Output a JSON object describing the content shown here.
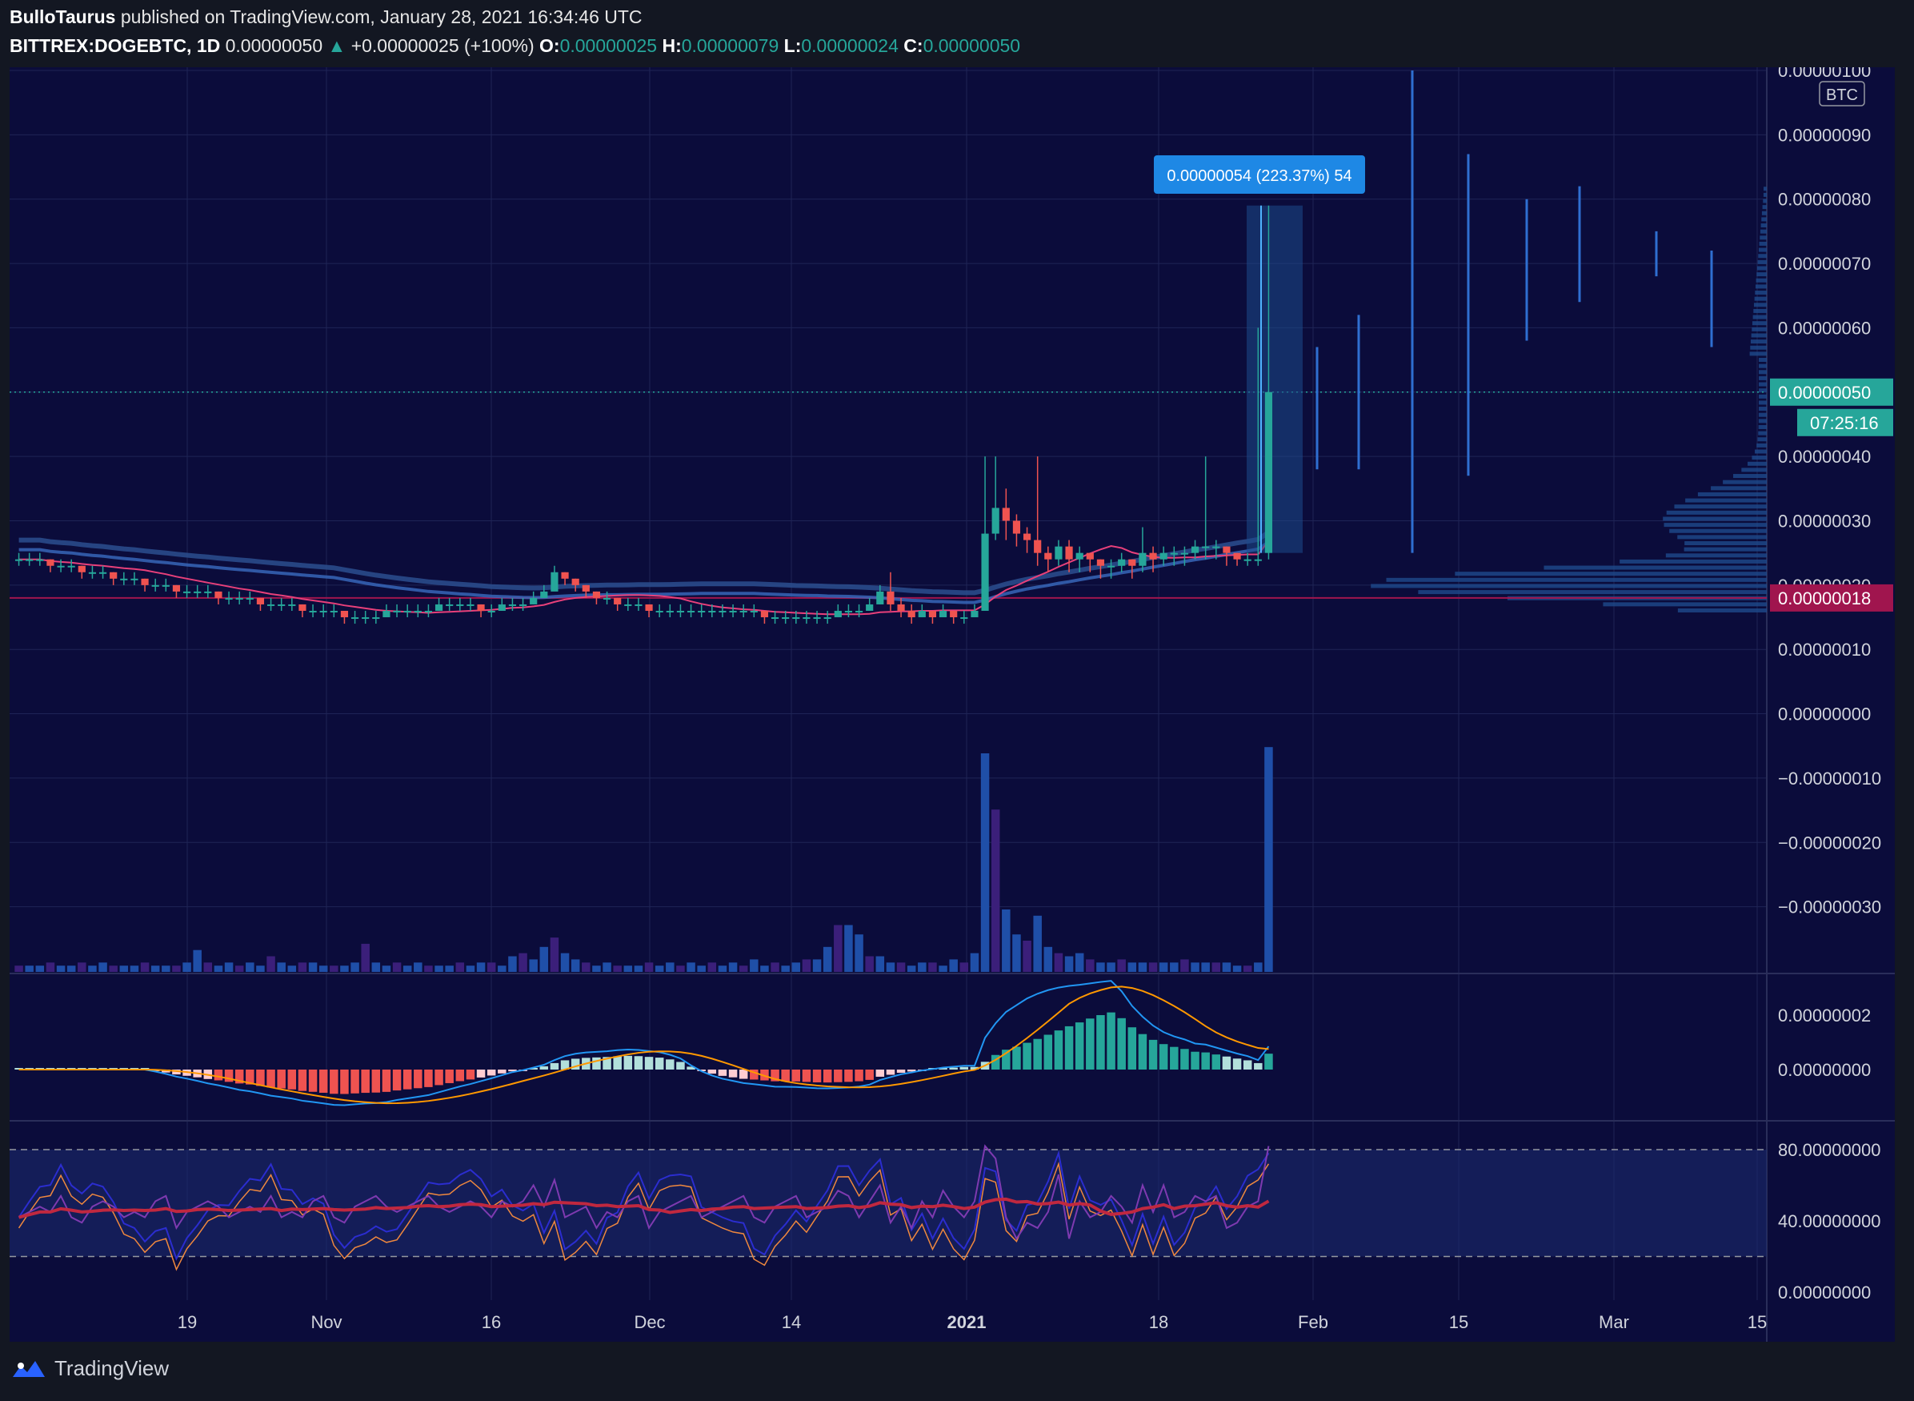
{
  "header": {
    "author": "BulloTaurus",
    "published": "published on TradingView.com, January 28, 2021 16:34:46 UTC",
    "symbol": "BITTREX:DOGEBTC, 1D",
    "last": "0.00000050",
    "change_arrow": "▲",
    "change": "+0.00000025 (+100%)",
    "o_label": "O:",
    "o": "0.00000025",
    "h_label": "H:",
    "h": "0.00000079",
    "l_label": "L:",
    "l": "0.00000024",
    "c_label": "C:",
    "c": "0.00000050"
  },
  "footer": {
    "brand": "TradingView",
    "logo_icon": "tradingview-logo-icon"
  },
  "colors": {
    "up": "#26a69a",
    "down": "#ef5350",
    "bg": "#0b0c3b",
    "accent": "#2962ff",
    "profile": "#1e4a8c",
    "measure": "#1e88e5",
    "low_line": "#a0154e"
  },
  "chart_data": [
    {
      "type": "candlestick",
      "title": "",
      "currency_badge": "BTC",
      "price_axis_labels": [
        "0.00000100",
        "0.00000090",
        "0.00000080",
        "0.00000070",
        "0.00000060",
        "0.00000050",
        "0.00000040",
        "0.00000030",
        "0.00000020",
        "0.00000018",
        "0.00000010",
        "0.00000000",
        "−0.00000010",
        "−0.00000020",
        "−0.00000030"
      ],
      "price_axis_values": [
        100,
        90,
        80,
        70,
        60,
        50,
        40,
        30,
        20,
        18,
        10,
        0,
        -10,
        -20,
        -30
      ],
      "ylim": [
        -35,
        100
      ],
      "value_unit_scale": "1e-8 BTC",
      "x_tick_labels": [
        "19",
        "Nov",
        "16",
        "Dec",
        "14",
        "2021",
        "18",
        "Feb",
        "15",
        "Mar",
        "15"
      ],
      "last_price_label": "0.00000050",
      "countdown_label": "07:25:16",
      "low_line_label": "0.00000018",
      "measure_label": "0.00000054 (223.37%) 54",
      "closes": [
        24,
        24,
        24,
        23,
        23,
        23,
        22,
        22,
        22,
        21,
        21,
        21,
        20,
        20,
        20,
        19,
        19,
        19,
        19,
        18,
        18,
        18,
        18,
        17,
        17,
        17,
        17,
        16,
        16,
        16,
        16,
        15,
        15,
        15,
        15,
        16,
        16,
        16,
        16,
        16,
        17,
        17,
        17,
        17,
        16,
        16,
        17,
        17,
        17,
        18,
        19,
        22,
        21,
        20,
        19,
        18,
        18,
        17,
        17,
        17,
        16,
        16,
        16,
        16,
        16,
        16,
        16,
        16,
        16,
        16,
        16,
        15,
        15,
        15,
        15,
        15,
        15,
        15,
        16,
        16,
        16,
        17,
        19,
        17,
        16,
        15,
        16,
        15,
        16,
        15,
        15,
        16,
        28,
        32,
        30,
        28,
        27,
        25,
        24,
        26,
        24,
        25,
        24,
        23,
        23,
        24,
        23,
        25,
        24,
        25,
        25,
        25,
        26,
        26,
        26,
        25,
        24,
        24,
        24,
        50
      ],
      "opens": [
        24,
        24,
        24,
        24,
        23,
        23,
        23,
        22,
        22,
        22,
        21,
        21,
        21,
        20,
        20,
        20,
        19,
        19,
        19,
        19,
        18,
        18,
        18,
        18,
        17,
        17,
        17,
        17,
        16,
        16,
        16,
        16,
        15,
        15,
        15,
        15,
        16,
        16,
        16,
        16,
        16,
        17,
        17,
        17,
        17,
        16,
        16,
        17,
        17,
        17,
        18,
        19,
        22,
        21,
        20,
        19,
        18,
        18,
        17,
        17,
        17,
        16,
        16,
        16,
        16,
        16,
        16,
        16,
        16,
        16,
        16,
        16,
        15,
        15,
        15,
        15,
        15,
        15,
        15,
        16,
        16,
        16,
        17,
        19,
        17,
        16,
        15,
        16,
        15,
        16,
        15,
        15,
        16,
        28,
        32,
        30,
        28,
        27,
        25,
        24,
        26,
        24,
        25,
        24,
        23,
        23,
        24,
        23,
        25,
        24,
        25,
        25,
        25,
        26,
        26,
        26,
        25,
        24,
        24,
        25
      ],
      "highs": [
        25,
        25,
        25,
        24,
        24,
        24,
        23,
        23,
        23,
        22,
        22,
        22,
        21,
        21,
        21,
        20,
        20,
        20,
        20,
        19,
        19,
        19,
        19,
        18,
        18,
        18,
        18,
        17,
        17,
        17,
        17,
        16,
        16,
        16,
        16,
        17,
        17,
        17,
        17,
        17,
        18,
        18,
        18,
        18,
        17,
        17,
        18,
        18,
        18,
        19,
        20,
        23,
        22,
        21,
        20,
        19,
        19,
        18,
        18,
        18,
        17,
        17,
        17,
        17,
        17,
        17,
        17,
        17,
        17,
        17,
        17,
        16,
        16,
        16,
        16,
        16,
        16,
        16,
        17,
        17,
        17,
        18,
        20,
        22,
        18,
        17,
        17,
        16,
        17,
        16,
        16,
        17,
        40,
        40,
        35,
        31,
        29,
        40,
        26,
        27,
        27,
        26,
        25,
        24,
        24,
        25,
        24,
        29,
        26,
        26,
        26,
        26,
        27,
        40,
        27,
        26,
        25,
        25,
        60,
        79
      ],
      "lows": [
        23,
        23,
        23,
        22,
        22,
        22,
        21,
        21,
        21,
        20,
        20,
        20,
        19,
        19,
        19,
        18,
        18,
        18,
        18,
        17,
        17,
        17,
        17,
        16,
        16,
        16,
        16,
        15,
        15,
        15,
        15,
        14,
        14,
        14,
        14,
        15,
        15,
        15,
        15,
        15,
        16,
        16,
        16,
        16,
        15,
        15,
        16,
        16,
        16,
        17,
        18,
        20,
        20,
        19,
        18,
        17,
        17,
        16,
        16,
        16,
        15,
        15,
        15,
        15,
        15,
        15,
        15,
        15,
        15,
        15,
        15,
        14,
        14,
        14,
        14,
        14,
        14,
        14,
        15,
        15,
        15,
        16,
        17,
        16,
        15,
        14,
        15,
        14,
        15,
        14,
        14,
        15,
        17,
        27,
        27,
        26,
        25,
        23,
        22,
        23,
        22,
        22,
        22,
        21,
        21,
        22,
        21,
        22,
        22,
        23,
        23,
        23,
        24,
        24,
        24,
        23,
        23,
        23,
        23,
        24
      ],
      "volume_rel": [
        2,
        2,
        2,
        3,
        2,
        2,
        3,
        2,
        3,
        2,
        2,
        2,
        3,
        2,
        2,
        2,
        3,
        7,
        3,
        2,
        3,
        2,
        3,
        2,
        5,
        3,
        2,
        3,
        3,
        2,
        2,
        2,
        3,
        9,
        3,
        2,
        3,
        2,
        3,
        2,
        2,
        2,
        3,
        2,
        3,
        3,
        2,
        5,
        6,
        4,
        8,
        11,
        6,
        4,
        3,
        2,
        3,
        2,
        2,
        2,
        3,
        2,
        3,
        2,
        3,
        2,
        3,
        2,
        3,
        2,
        4,
        2,
        3,
        2,
        3,
        4,
        4,
        8,
        15,
        15,
        12,
        5,
        5,
        3,
        3,
        2,
        3,
        3,
        2,
        4,
        3,
        6,
        70,
        52,
        20,
        12,
        10,
        18,
        8,
        6,
        5,
        6,
        4,
        3,
        3,
        4,
        3,
        3,
        3,
        3,
        3,
        4,
        3,
        3,
        3,
        3,
        2,
        2,
        3,
        72
      ],
      "ma_ribbon": "moving averages overlay",
      "volume_profile": "visible range histogram on right edge"
    },
    {
      "type": "macd",
      "axis_labels": [
        "0.00000002",
        "0.00000000"
      ],
      "axis_values": [
        2,
        0
      ]
    },
    {
      "type": "oscillator",
      "axis_labels": [
        "80.00000000",
        "40.00000000",
        "0.00000000"
      ],
      "axis_values": [
        80,
        40,
        0
      ],
      "bands": [
        80,
        20
      ]
    }
  ]
}
